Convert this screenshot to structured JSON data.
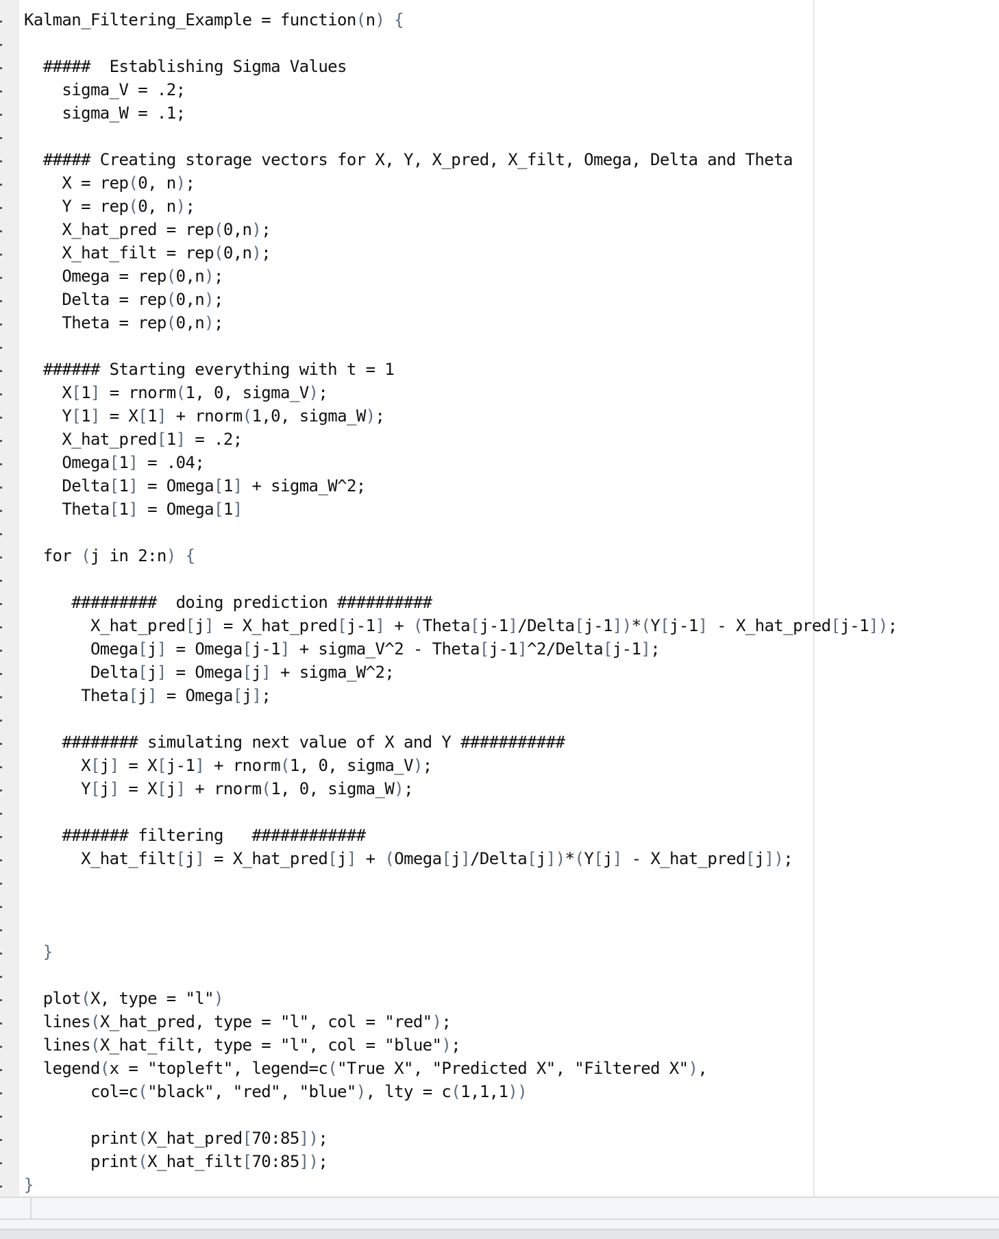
{
  "editor": {
    "language": "R",
    "lines": [
      {
        "indent": 0,
        "text": "Kalman_Filtering_Example = function(n) {"
      },
      {
        "indent": 0,
        "text": ""
      },
      {
        "indent": 2,
        "text": "#####  Establishing Sigma Values"
      },
      {
        "indent": 4,
        "text": "sigma_V = .2;"
      },
      {
        "indent": 4,
        "text": "sigma_W = .1;"
      },
      {
        "indent": 0,
        "text": ""
      },
      {
        "indent": 2,
        "text": "##### Creating storage vectors for X, Y, X_pred, X_filt, Omega, Delta and Theta"
      },
      {
        "indent": 4,
        "text": "X = rep(0, n);"
      },
      {
        "indent": 4,
        "text": "Y = rep(0, n);"
      },
      {
        "indent": 4,
        "text": "X_hat_pred = rep(0,n);"
      },
      {
        "indent": 4,
        "text": "X_hat_filt = rep(0,n);"
      },
      {
        "indent": 4,
        "text": "Omega = rep(0,n);"
      },
      {
        "indent": 4,
        "text": "Delta = rep(0,n);"
      },
      {
        "indent": 4,
        "text": "Theta = rep(0,n);"
      },
      {
        "indent": 0,
        "text": ""
      },
      {
        "indent": 2,
        "text": "###### Starting everything with t = 1"
      },
      {
        "indent": 4,
        "text": "X[1] = rnorm(1, 0, sigma_V);"
      },
      {
        "indent": 4,
        "text": "Y[1] = X[1] + rnorm(1,0, sigma_W);"
      },
      {
        "indent": 4,
        "text": "X_hat_pred[1] = .2;"
      },
      {
        "indent": 4,
        "text": "Omega[1] = .04;"
      },
      {
        "indent": 4,
        "text": "Delta[1] = Omega[1] + sigma_W^2;"
      },
      {
        "indent": 4,
        "text": "Theta[1] = Omega[1]"
      },
      {
        "indent": 0,
        "text": ""
      },
      {
        "indent": 2,
        "text": "for (j in 2:n) {"
      },
      {
        "indent": 0,
        "text": ""
      },
      {
        "indent": 5,
        "text": "#########  doing prediction ##########"
      },
      {
        "indent": 7,
        "text": "X_hat_pred[j] = X_hat_pred[j-1] + (Theta[j-1]/Delta[j-1])*(Y[j-1] - X_hat_pred[j-1]);"
      },
      {
        "indent": 7,
        "text": "Omega[j] = Omega[j-1] + sigma_V^2 - Theta[j-1]^2/Delta[j-1];"
      },
      {
        "indent": 7,
        "text": "Delta[j] = Omega[j] + sigma_W^2;"
      },
      {
        "indent": 6,
        "text": "Theta[j] = Omega[j];"
      },
      {
        "indent": 0,
        "text": ""
      },
      {
        "indent": 4,
        "text": "######## simulating next value of X and Y ###########"
      },
      {
        "indent": 6,
        "text": "X[j] = X[j-1] + rnorm(1, 0, sigma_V);"
      },
      {
        "indent": 6,
        "text": "Y[j] = X[j] + rnorm(1, 0, sigma_W);"
      },
      {
        "indent": 0,
        "text": ""
      },
      {
        "indent": 4,
        "text": "####### filtering   ############"
      },
      {
        "indent": 6,
        "text": "X_hat_filt[j] = X_hat_pred[j] + (Omega[j]/Delta[j])*(Y[j] - X_hat_pred[j]);"
      },
      {
        "indent": 0,
        "text": ""
      },
      {
        "indent": 0,
        "text": ""
      },
      {
        "indent": 0,
        "text": ""
      },
      {
        "indent": 2,
        "text": "}"
      },
      {
        "indent": 0,
        "text": ""
      },
      {
        "indent": 2,
        "text": "plot(X, type = \"l\")"
      },
      {
        "indent": 2,
        "text": "lines(X_hat_pred, type = \"l\", col = \"red\");"
      },
      {
        "indent": 2,
        "text": "lines(X_hat_filt, type = \"l\", col = \"blue\");"
      },
      {
        "indent": 2,
        "text": "legend(x = \"topleft\", legend=c(\"True X\", \"Predicted X\", \"Filtered X\"),"
      },
      {
        "indent": 7,
        "text": "col=c(\"black\", \"red\", \"blue\"), lty = c(1,1,1))"
      },
      {
        "indent": 0,
        "text": ""
      },
      {
        "indent": 7,
        "text": "print(X_hat_pred[70:85]);"
      },
      {
        "indent": 7,
        "text": "print(X_hat_filt[70:85]);"
      },
      {
        "indent": 0,
        "text": "}"
      }
    ]
  },
  "colors": {
    "text": "#111111",
    "bracket": "#5c6b7e",
    "gutter": "#efefef",
    "margin_line": "#e6e6e6",
    "bottom_panel": "#f4f6f7"
  }
}
